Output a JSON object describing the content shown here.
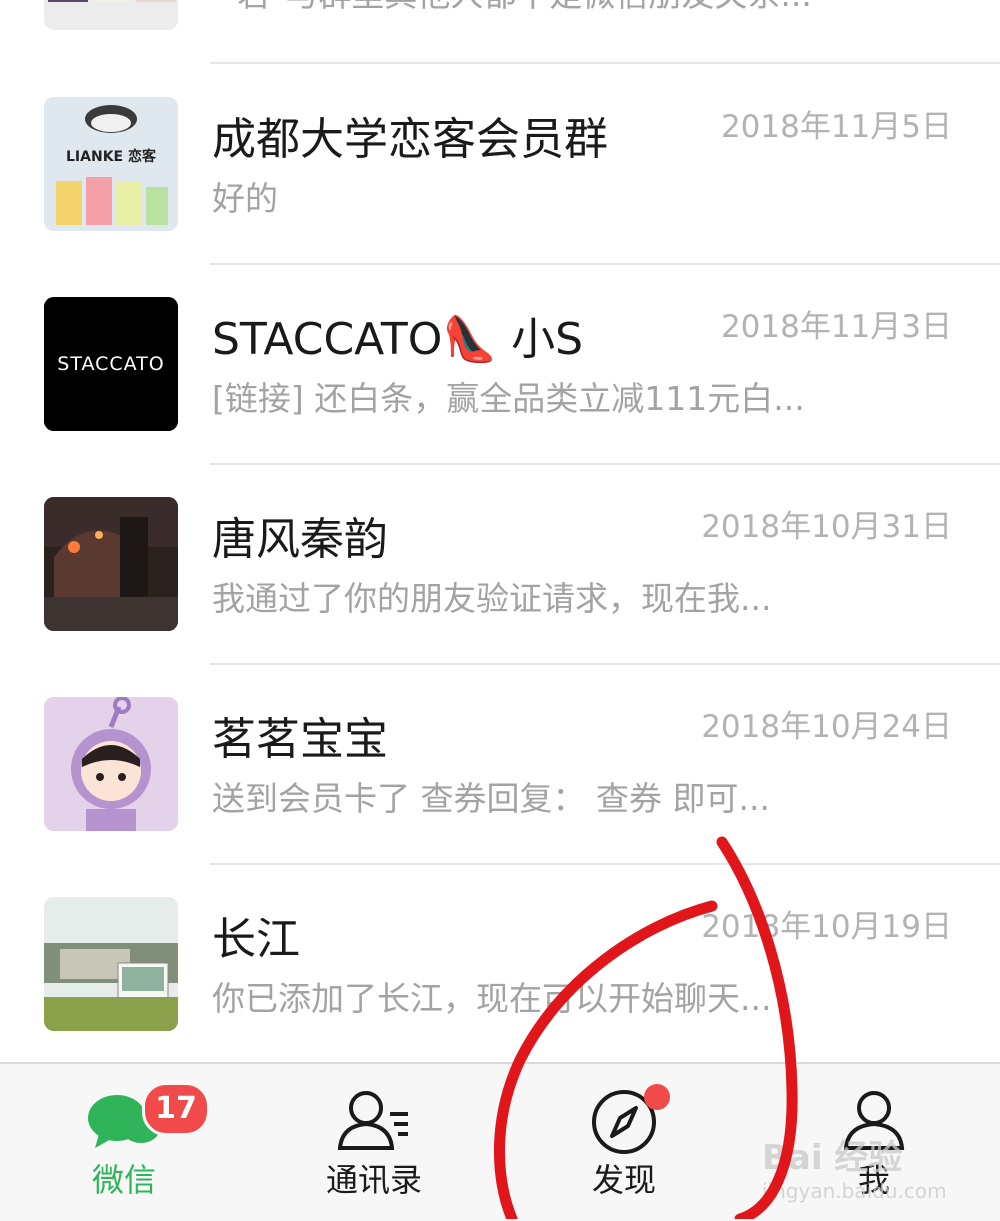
{
  "chats": [
    {
      "name": "",
      "preview": "\"若\"与群里其他人都不是微信朋友关系...",
      "time": ""
    },
    {
      "name": "成都大学恋客会员群",
      "preview": "好的",
      "time": "2018年11月5日",
      "avatar_text": "LIANKE 恋客"
    },
    {
      "name": "STACCATO👠 小S",
      "preview": "[链接] 还白条，赢全品类立减111元白...",
      "time": "2018年11月3日",
      "avatar_text": "STACCATO"
    },
    {
      "name": "唐风秦韵",
      "preview": "我通过了你的朋友验证请求，现在我...",
      "time": "2018年10月31日"
    },
    {
      "name": "茗茗宝宝",
      "preview": "送到会员卡了 查券回复： 查券 即可...",
      "time": "2018年10月24日"
    },
    {
      "name": "长江",
      "preview": "你已添加了长江，现在可以开始聊天...",
      "time": "2018年10月19日"
    }
  ],
  "tabbar": {
    "tabs": [
      {
        "label": "微信",
        "icon": "chat-bubbles-icon",
        "active": true,
        "badge": "17"
      },
      {
        "label": "通讯录",
        "icon": "contacts-icon"
      },
      {
        "label": "发现",
        "icon": "compass-icon",
        "dot": true
      },
      {
        "label": "我",
        "icon": "person-icon"
      }
    ]
  },
  "watermark": {
    "text": "Bai 经验",
    "sub": "jingyan.baidu.com"
  },
  "colors": {
    "accent": "#2fb45a",
    "badge": "#f04a4a",
    "annotation": "#e0161b"
  }
}
